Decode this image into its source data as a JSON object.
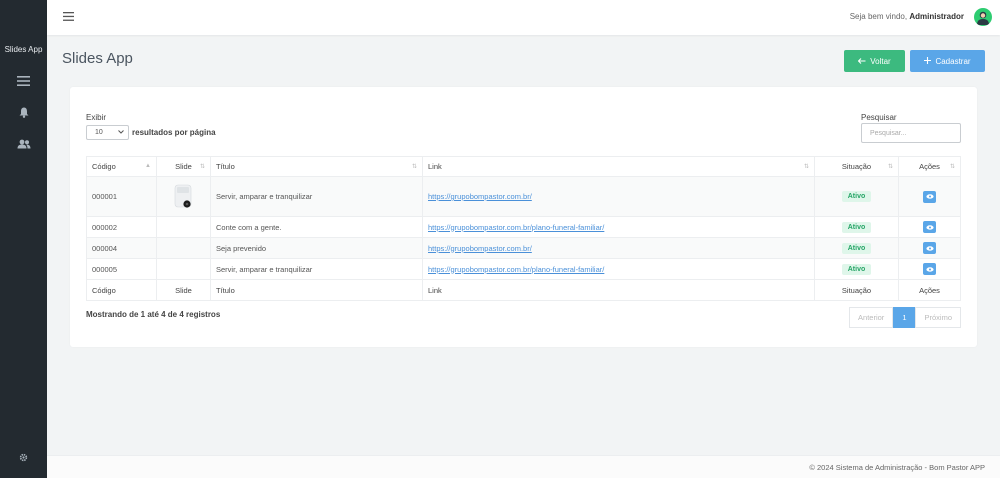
{
  "sidebar": {
    "brand": "Slides App"
  },
  "header": {
    "welcome_prefix": "Seja bem vindo,",
    "user": "Administrador"
  },
  "page": {
    "title": "Slides App"
  },
  "buttons": {
    "back": "Voltar",
    "new": "Cadastrar"
  },
  "controls": {
    "show_label": "Exibir",
    "page_size": "10",
    "per_page_label": "resultados por página",
    "search_label": "Pesquisar",
    "search_placeholder": "Pesquisar..."
  },
  "table": {
    "columns": [
      "Código",
      "Slide",
      "Título",
      "Link",
      "Situação",
      "Ações"
    ],
    "rows": [
      {
        "code": "000001",
        "title": "Servir, amparar e tranquilizar",
        "link": "https://grupobompastor.com.br/",
        "status": "Ativo"
      },
      {
        "code": "000002",
        "title": "Conte com a gente.",
        "link": "https://grupobompastor.com.br/plano-funeral-familiar/",
        "status": "Ativo"
      },
      {
        "code": "000004",
        "title": "Seja prevenido",
        "link": "https://grupobompastor.com.br/",
        "status": "Ativo"
      },
      {
        "code": "000005",
        "title": "Servir, amparar e tranquilizar",
        "link": "https://grupobompastor.com.br/plano-funeral-familiar/",
        "status": "Ativo"
      }
    ]
  },
  "info": "Mostrando de 1 até 4 de 4 registros",
  "pagination": {
    "prev": "Anterior",
    "current": "1",
    "next": "Próximo"
  },
  "footer": "© 2024 Sistema de Administração - Bom Pastor APP",
  "colors": {
    "sidebar": "#232a30",
    "success": "#3cba7f",
    "primary": "#5aa6e8"
  }
}
